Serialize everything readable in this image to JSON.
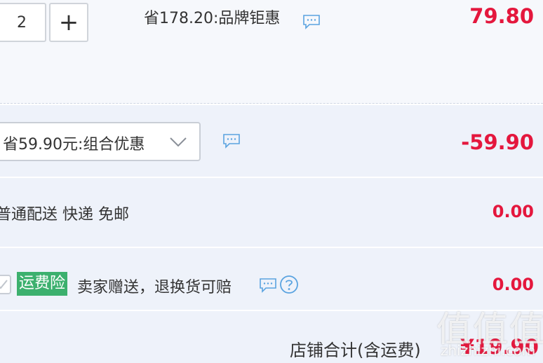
{
  "item": {
    "quantity": "2",
    "plus_label": "+",
    "promo_text": "省178.20:品牌钜惠",
    "price": "79.80"
  },
  "combo": {
    "selected_label": "省59.90元:组合优惠",
    "discount": "-59.90"
  },
  "shipping": {
    "text": "普通配送 快递 免邮",
    "fee": "0.00"
  },
  "insurance": {
    "tag": "运费险",
    "description": "卖家赠送，退换货可赔",
    "fee": "0.00"
  },
  "total": {
    "label": "店铺合计(含运费)",
    "value": "¥19.90"
  },
  "watermark": {
    "main": "值值值",
    "sub": "zhizhizhi.com"
  },
  "colors": {
    "price_red": "#e4173d",
    "band_bg": "#eef2fa",
    "insurance_green": "#3cb06e",
    "icon_blue": "#5aa3e0"
  },
  "icons": [
    "chat-bubble-icon",
    "chevron-down-icon",
    "question-icon",
    "checkbox-icon"
  ]
}
